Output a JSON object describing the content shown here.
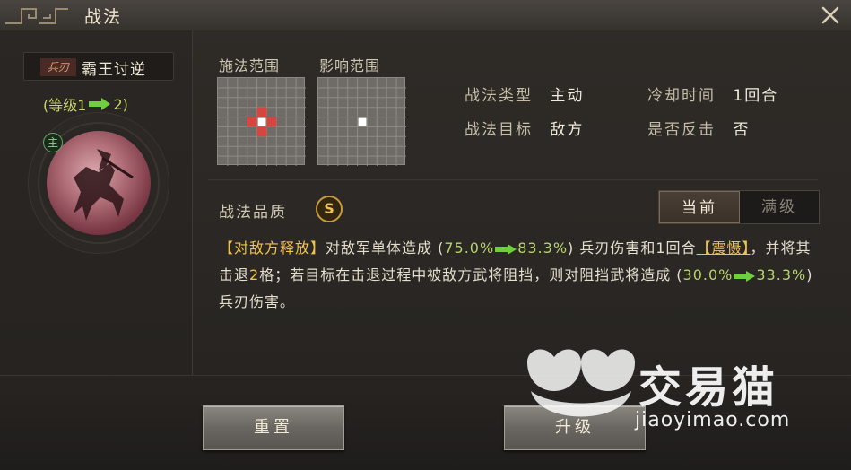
{
  "window": {
    "title": "战法"
  },
  "skill": {
    "type_tag": "兵刃",
    "name": "霸王讨逆",
    "level_open": "(等级1",
    "level_close": "2)",
    "main_badge": "主"
  },
  "range": {
    "cast_label": "施法范围",
    "effect_label": "影响范围"
  },
  "info": {
    "type_key": "战法类型",
    "type_val": "主动",
    "cooldown_key": "冷却时间",
    "cooldown_val": "1回合",
    "target_key": "战法目标",
    "target_val": "敌方",
    "counter_key": "是否反击",
    "counter_val": "否"
  },
  "quality": {
    "label": "战法品质",
    "grade": "S"
  },
  "toggle": {
    "current": "当前",
    "max": "满级"
  },
  "description": {
    "p1": "【对敌方释放】",
    "p2": "对敌军单体造成 (",
    "v1a": "75.0%",
    "v1b": "83.3%",
    "p3": ") 兵刃伤害和1回合",
    "p4": "【震慑】",
    "p5": "，并将其击退",
    "p6": "2",
    "p7": "格；若目标在击退过程中被敌方武将阻挡，则对阻挡武将造成 (",
    "v2a": "30.0%",
    "v2b": "33.3%",
    "p8": ") 兵刃伤害。"
  },
  "buttons": {
    "reset": "重置",
    "upgrade": "升级"
  },
  "watermark": {
    "brand": "交易猫",
    "url": "jiaoyimao.com"
  },
  "colors": {
    "highlight": "#f0c34a",
    "value_green": "#b7d36a",
    "cast_cell": "#d6453f",
    "center_cell": "#ffffff"
  }
}
